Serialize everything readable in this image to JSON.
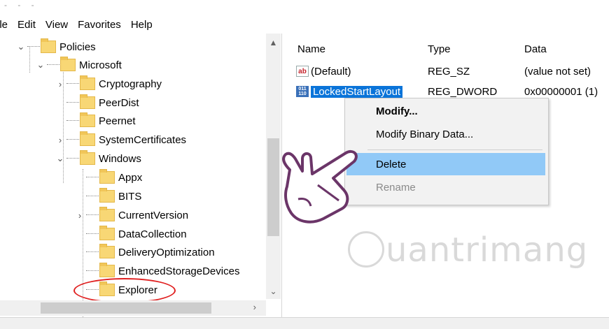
{
  "menu": {
    "items": [
      "ile",
      "Edit",
      "View",
      "Favorites",
      "Help"
    ]
  },
  "tree": {
    "items": [
      {
        "label": "Policies",
        "expander": "open"
      },
      {
        "label": "Microsoft",
        "expander": "open"
      },
      {
        "label": "Cryptography",
        "expander": "closed"
      },
      {
        "label": "PeerDist",
        "expander": "none"
      },
      {
        "label": "Peernet",
        "expander": "none"
      },
      {
        "label": "SystemCertificates",
        "expander": "closed"
      },
      {
        "label": "Windows",
        "expander": "open"
      },
      {
        "label": "Appx",
        "expander": "none"
      },
      {
        "label": "BITS",
        "expander": "none"
      },
      {
        "label": "CurrentVersion",
        "expander": "closed"
      },
      {
        "label": "DataCollection",
        "expander": "none"
      },
      {
        "label": "DeliveryOptimization",
        "expander": "none"
      },
      {
        "label": "EnhancedStorageDevices",
        "expander": "none"
      },
      {
        "label": "Explorer",
        "expander": "none"
      }
    ]
  },
  "values": {
    "headers": {
      "name": "Name",
      "type": "Type",
      "data": "Data"
    },
    "rows": [
      {
        "icon": "ab",
        "name": "(Default)",
        "type": "REG_SZ",
        "data": "(value not set)"
      },
      {
        "icon": "011\n110",
        "name": "LockedStartLayout",
        "type": "REG_DWORD",
        "data": "0x00000001 (1)"
      }
    ]
  },
  "context_menu": {
    "items": [
      {
        "label": "Modify...",
        "state": "default"
      },
      {
        "label": "Modify Binary Data...",
        "state": "normal"
      },
      {
        "label": "Delete",
        "state": "hover"
      },
      {
        "label": "Rename",
        "state": "disabled"
      }
    ]
  },
  "watermark": {
    "text": "uantrimang"
  },
  "colors": {
    "selection": "#0a74d9",
    "hover": "#91c9f7",
    "folder": "#f8d775",
    "highlight": "#e02020"
  }
}
